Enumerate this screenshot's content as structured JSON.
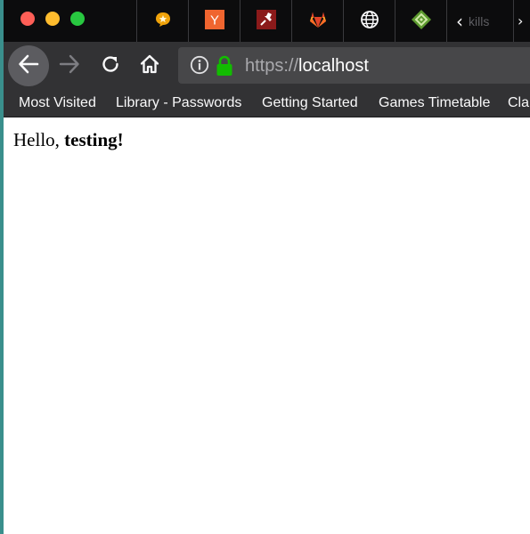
{
  "window": {
    "controls": [
      "close",
      "minimize",
      "zoom"
    ]
  },
  "tabs": [
    {
      "icon": "star-chat-icon"
    },
    {
      "icon": "ycombinator-icon",
      "glyph": "Y"
    },
    {
      "icon": "pin-icon"
    },
    {
      "icon": "gitlab-icon"
    },
    {
      "icon": "globe-icon"
    },
    {
      "icon": "green-diamond-icon"
    }
  ],
  "tab_scroll": {
    "chevron": "‹",
    "partial_label": "kills",
    "overflow_glyph": "›"
  },
  "navigation": {
    "buttons": [
      "back",
      "forward",
      "reload",
      "home"
    ]
  },
  "urlbar": {
    "scheme": "https://",
    "host": "localhost",
    "secure": true
  },
  "bookmarks": [
    {
      "label": "Most Visited"
    },
    {
      "label": "Library - Passwords"
    },
    {
      "label": "Getting Started"
    },
    {
      "label": "Games Timetable"
    },
    {
      "label": "Cla"
    }
  ],
  "page": {
    "greeting_prefix": "Hello, ",
    "greeting_name": "testing!"
  },
  "colors": {
    "tab_strip": "#0c0c0d",
    "toolbar": "#323234",
    "urlbar": "#474749",
    "lock_green": "#12bc00",
    "desktop": "#3a8f8c"
  }
}
